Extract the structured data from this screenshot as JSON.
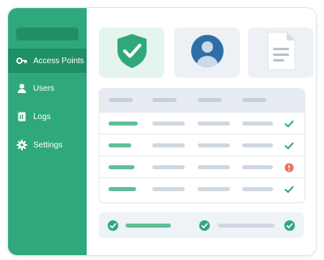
{
  "sidebar": {
    "items": [
      {
        "label": "Access Points",
        "icon": "key-icon",
        "active": true
      },
      {
        "label": "Users",
        "icon": "user-icon",
        "active": false
      },
      {
        "label": "Logs",
        "icon": "log-icon",
        "active": false
      },
      {
        "label": "Settings",
        "icon": "gear-icon",
        "active": false
      }
    ]
  },
  "cards": [
    {
      "icon": "shield-check-icon"
    },
    {
      "icon": "user-avatar-icon"
    },
    {
      "icon": "document-icon"
    }
  ],
  "table": {
    "rows": [
      {
        "status": "ok"
      },
      {
        "status": "ok"
      },
      {
        "status": "warning"
      },
      {
        "status": "ok"
      }
    ]
  },
  "colors": {
    "primary": "#2fa97c",
    "primary_dark": "#1f8f66",
    "ok": "#2fa97c",
    "warning": "#e8735a",
    "avatar": "#2f6fa8",
    "card_green_bg": "#e4f5ee",
    "card_gray_bg": "#edf1f5",
    "placeholder": "#cfd7e0"
  }
}
